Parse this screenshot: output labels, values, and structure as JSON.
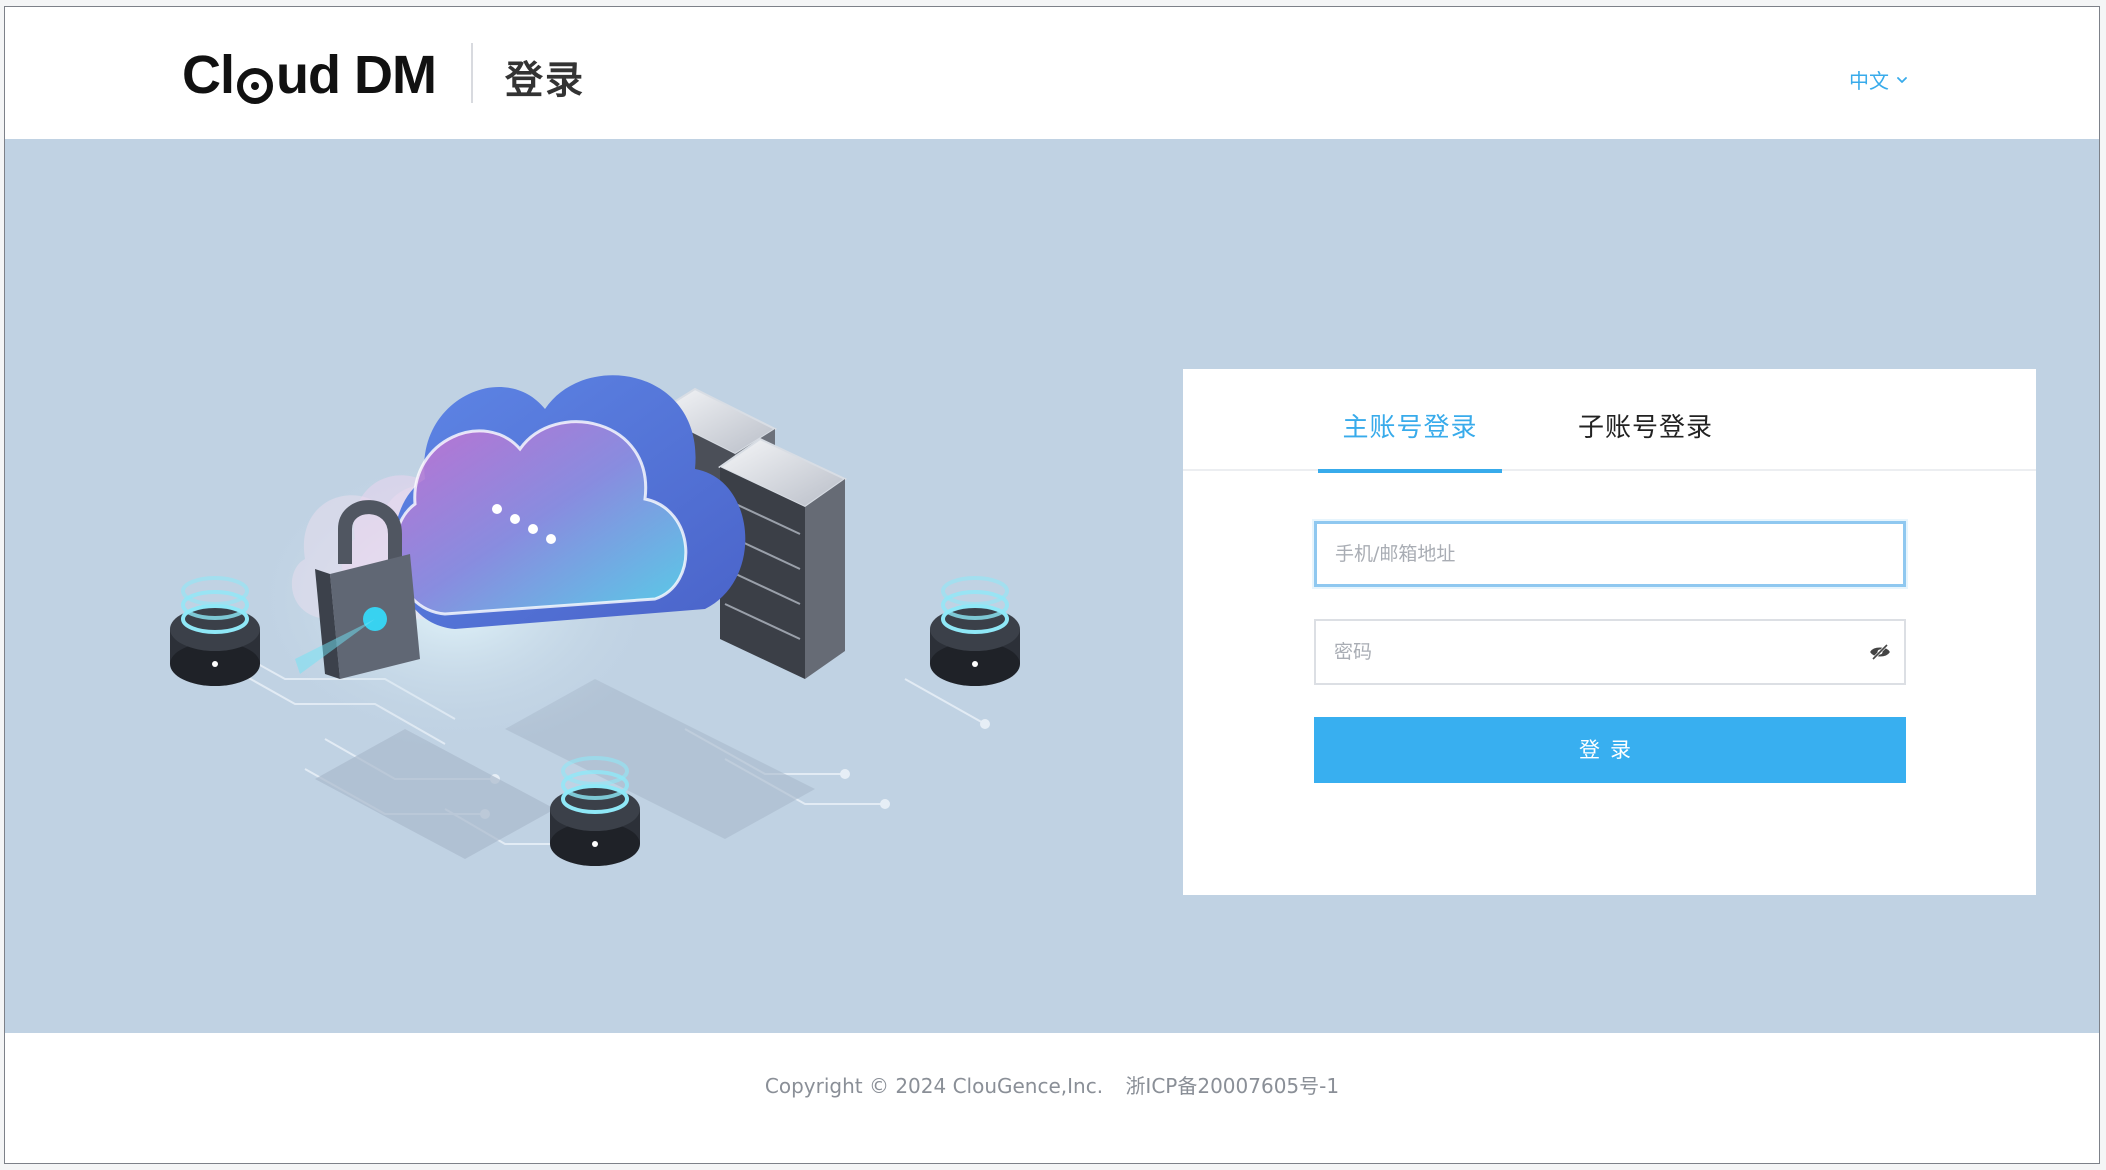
{
  "header": {
    "logo_text_left": "Cl",
    "logo_text_mid": "ud",
    "logo_text_right": "DM",
    "page_title": "登录",
    "language": "中文"
  },
  "login": {
    "tabs": [
      {
        "label": "主账号登录",
        "active": true
      },
      {
        "label": "子账号登录",
        "active": false
      }
    ],
    "account_placeholder": "手机/邮箱地址",
    "account_value": "",
    "password_placeholder": "密码",
    "password_value": "",
    "submit_label": "登录"
  },
  "footer": {
    "copyright": "Copyright © 2024 ClouGence,Inc.",
    "icp": "浙ICP备20007605号-1"
  },
  "colors": {
    "accent": "#38abeb",
    "button": "#38aff0",
    "banner_bg": "#c0d2e3",
    "footer_text": "#8a8f97"
  },
  "icons": {
    "language_dropdown": "chevron-down-icon",
    "password_toggle": "eye-off-icon"
  }
}
